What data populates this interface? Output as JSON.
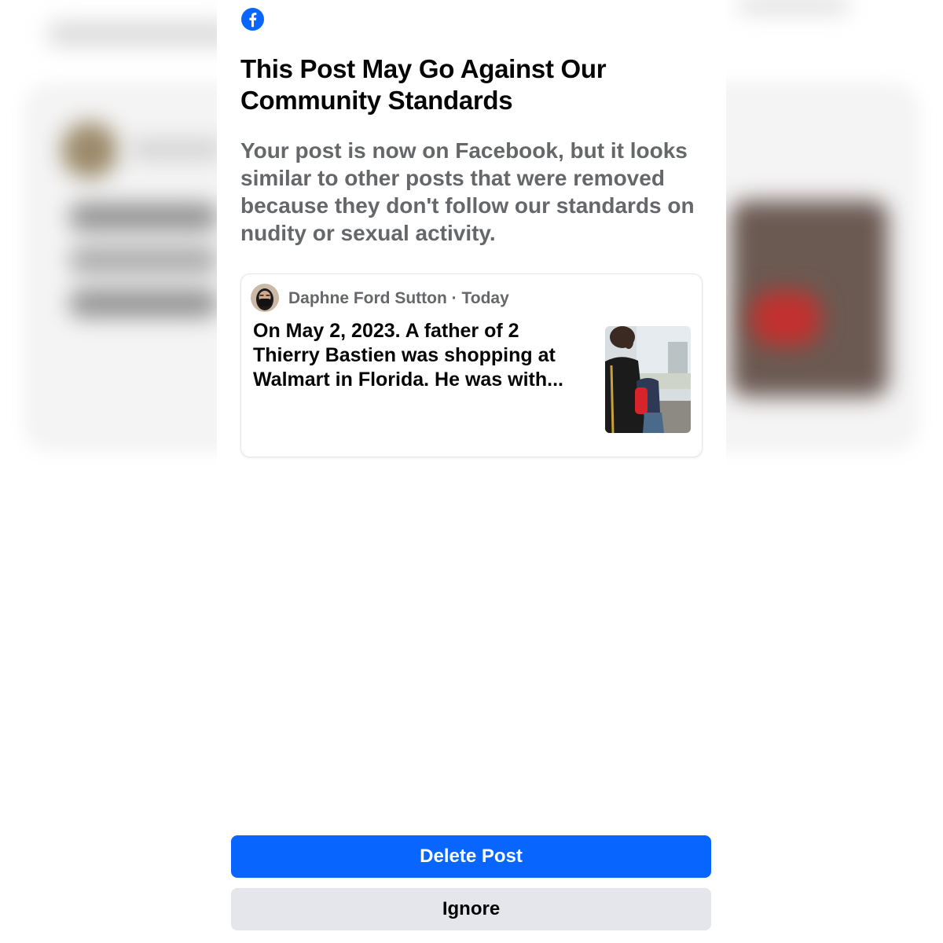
{
  "colors": {
    "brand": "#0866ff",
    "title_text": "#050505",
    "secondary_text": "#65676b",
    "ignore_button_bg": "#e4e6eb"
  },
  "dialog": {
    "logo_icon": "facebook-logo-icon",
    "title": "This Post May Go Against Our Community Standards",
    "description": "Your post is now on Facebook, but it looks similar to other posts that were removed because they don't follow our standards on nudity or sexual activity."
  },
  "post_preview": {
    "author": "Daphne Ford Sutton",
    "separator": "·",
    "time": "Today",
    "text": "On May 2, 2023. A father of 2 Thierry Bastien was shopping at Walmart in Florida. He was with...",
    "avatar_icon": "masked-person-avatar",
    "thumbnail_icon": "photo-thumbnail"
  },
  "actions": {
    "delete_label": "Delete Post",
    "ignore_label": "Ignore"
  }
}
